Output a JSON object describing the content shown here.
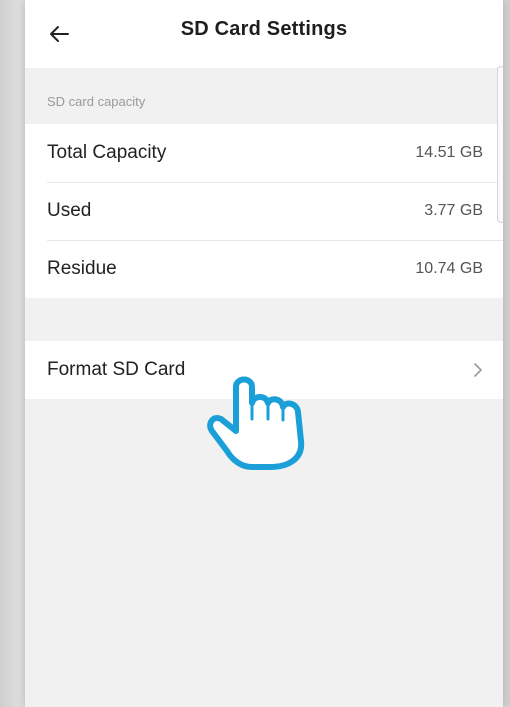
{
  "header": {
    "title": "SD Card Settings",
    "back_icon": "arrow-left-icon"
  },
  "capacity": {
    "section_label": "SD card capacity",
    "rows": [
      {
        "label": "Total Capacity",
        "value": "14.51 GB"
      },
      {
        "label": "Used",
        "value": "3.77 GB"
      },
      {
        "label": "Residue",
        "value": "10.74 GB"
      }
    ]
  },
  "actions": {
    "format_label": "Format SD Card",
    "chevron_icon": "chevron-right-icon"
  },
  "overlay": {
    "pointer_icon": "pointing-hand-icon",
    "pointer_color": "#1a9fd9"
  },
  "colors": {
    "background": "#f1f1f1",
    "surface": "#ffffff",
    "text": "#222222",
    "muted": "#9a9a9a"
  }
}
